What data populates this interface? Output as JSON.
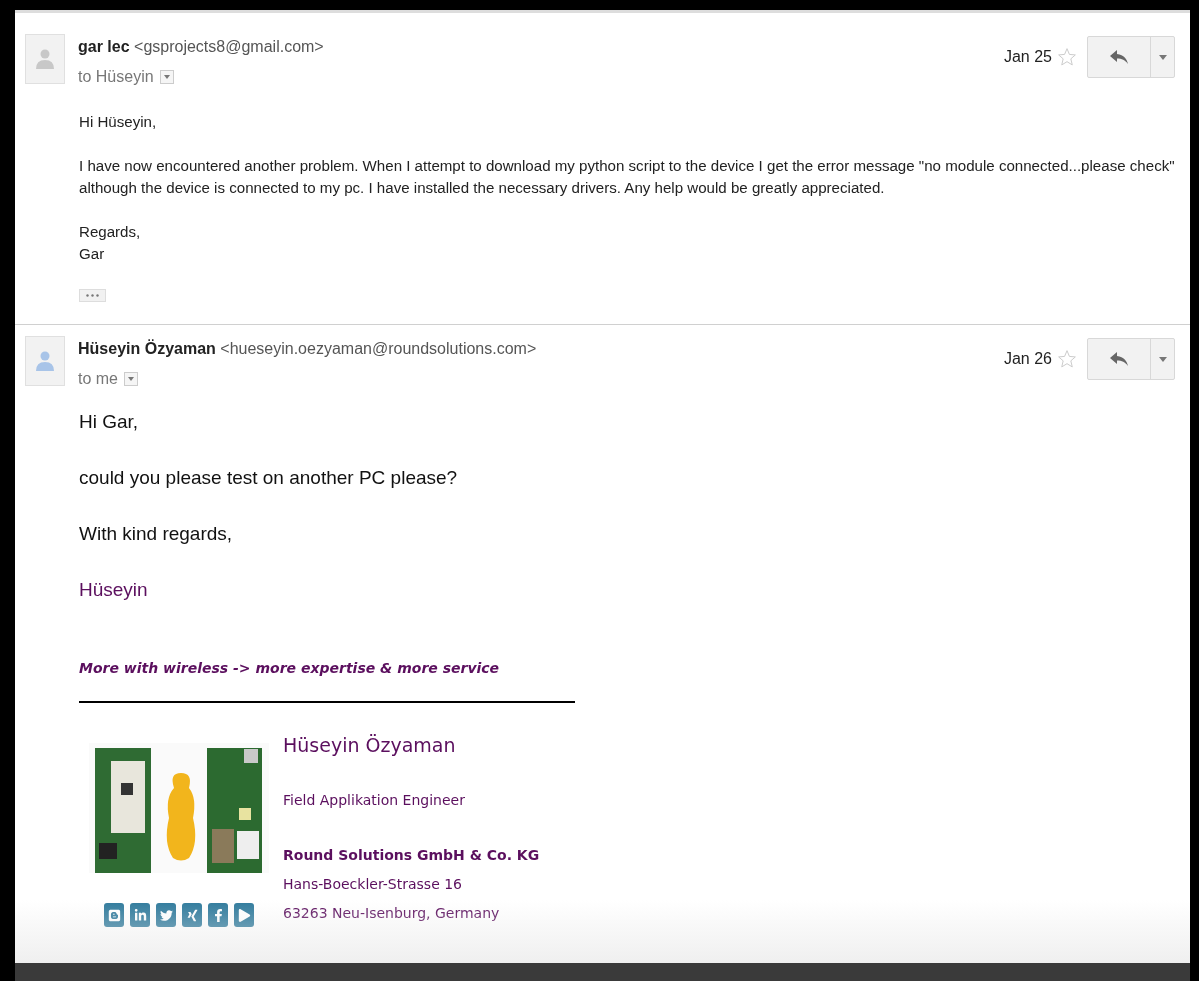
{
  "messages": [
    {
      "sender_name": "gar lec",
      "sender_email": "<gsprojects8@gmail.com>",
      "recipient": "to Hüseyin",
      "date": "Jan 25",
      "starred": false,
      "color": "#c8c8c8",
      "kind": "compact",
      "trimmed_content": true,
      "body": [
        {
          "kind": "plain",
          "text": "Hi Hüseyin,"
        },
        {
          "kind": "plain",
          "text": "I have now encountered another problem. When I attempt to download my python script to the device I get the error message \"no module connected...please check\" although the device is connected to my pc. I have installed the necessary drivers. Any help would be greatly appreciated."
        },
        {
          "kind": "lines",
          "lines": [
            "Regards,",
            "Gar"
          ]
        }
      ]
    },
    {
      "sender_name": "Hüseyin Özyaman",
      "sender_email": "<hueseyin.oezyaman@roundsolutions.com>",
      "recipient": "to me",
      "date": "Jan 26",
      "starred": false,
      "color": "#a8c4e8",
      "kind": "full",
      "trimmed_content": false,
      "body": [
        {
          "kind": "plain",
          "text": "Hi Gar,"
        },
        {
          "kind": "plain",
          "text": "could you please test on another PC please?"
        },
        {
          "kind": "plain",
          "text": "With kind regards,"
        },
        {
          "kind": "accent",
          "text": "Hüseyin"
        }
      ],
      "signature": {
        "tagline": "More with wireless -> more expertise & more service",
        "name": "Hüseyin Özyaman",
        "title": "Field Applikation Engineer",
        "company": "Round Solutions GmbH & Co. KG",
        "address": [
          "Hans-Boeckler-Strasse 16",
          "63263 Neu-Isenburg, Germany"
        ]
      }
    }
  ]
}
